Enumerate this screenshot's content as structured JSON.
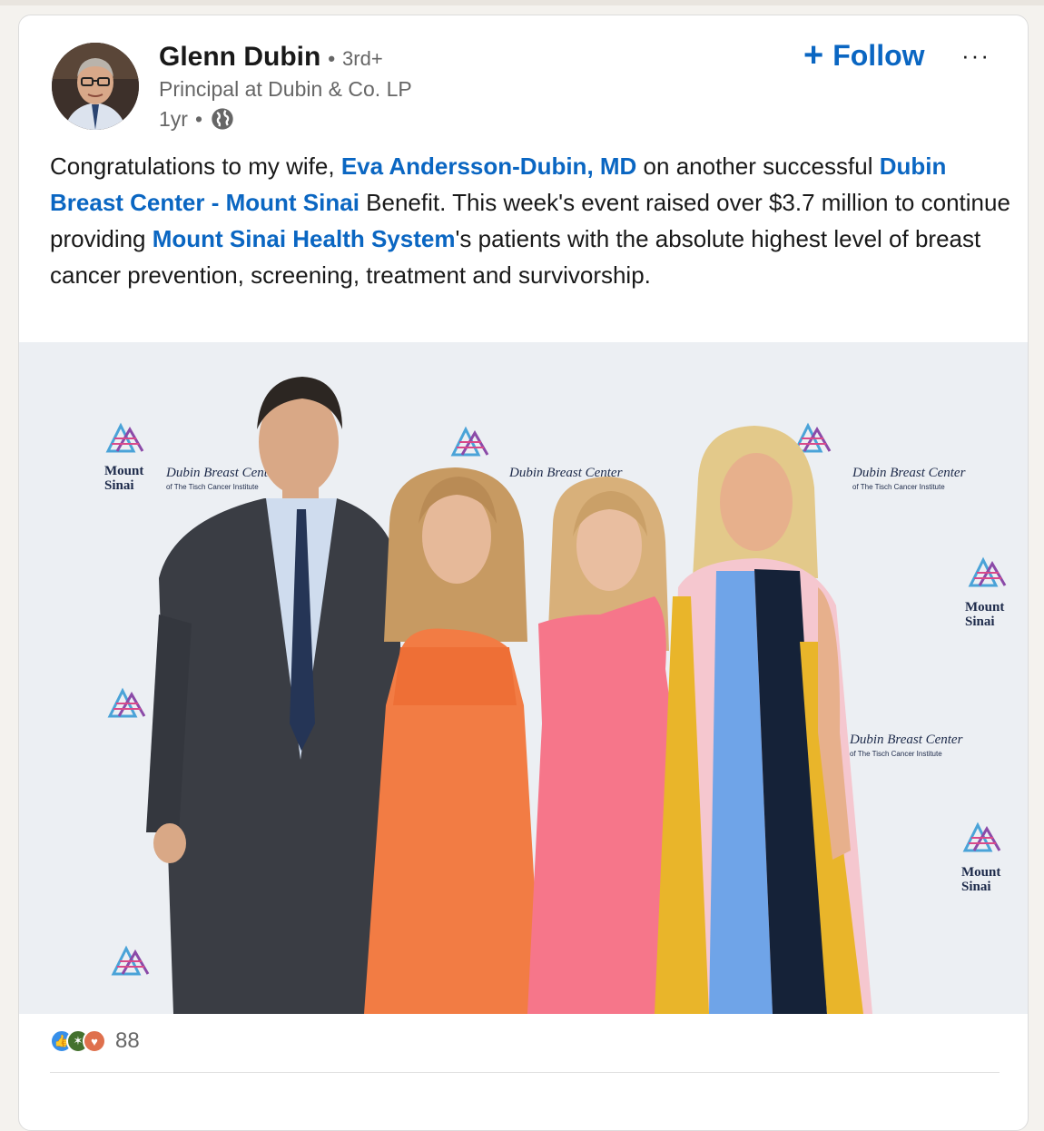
{
  "post": {
    "author": {
      "name": "Glenn Dubin",
      "separator": "•",
      "degree": "3rd+",
      "headline": "Principal at Dubin & Co. LP",
      "time": "1yr",
      "time_separator": "•",
      "visibility_icon": "globe-icon"
    },
    "follow_label": "Follow",
    "follow_icon": "plus-icon",
    "more_icon": "ellipsis-icon",
    "body": {
      "t1": "Congratulations to my wife, ",
      "mention1": "Eva Andersson-Dubin, MD",
      "t2": " on another successful ",
      "mention2": "Dubin Breast Center - Mount Sinai",
      "t3": " Benefit. This week's event raised over $3.7 million to continue providing ",
      "mention3": "Mount Sinai Health System",
      "t4": "'s patients with the absolute highest level of breast cancer prevention, screening, treatment and survivorship."
    },
    "photo": {
      "backdrop_logo": "Mount",
      "backdrop_logo2": "Sinai",
      "backdrop_center": "Dubin Breast Center",
      "backdrop_sub": "of The Tisch Cancer Institute"
    },
    "reactions": {
      "icons": [
        "like-icon",
        "celebrate-icon",
        "love-icon"
      ],
      "count": "88"
    }
  },
  "colors": {
    "link": "#0a66c2",
    "muted": "#666666",
    "text": "#191919"
  }
}
